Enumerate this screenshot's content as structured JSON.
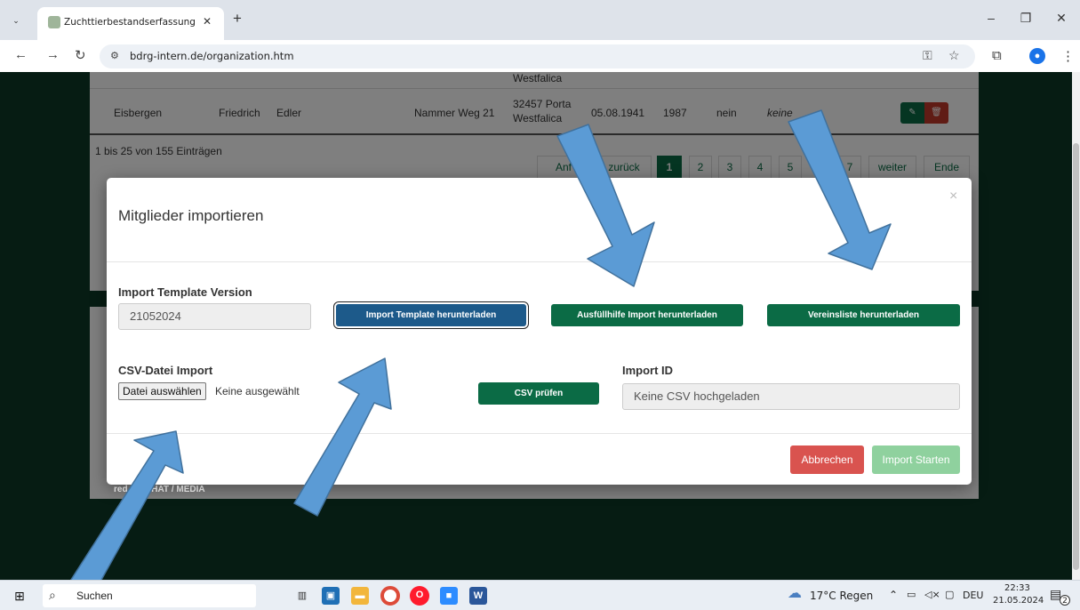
{
  "browser": {
    "tab_title": "Zuchttierbestandserfassung der",
    "url": "bdrg-intern.de/organization.htm"
  },
  "table": {
    "prev_row_city_fragment": "Westfalica",
    "row": {
      "lastname": "Eisbergen",
      "firstname": "Friedrich",
      "title": "Edler",
      "street": "Nammer Weg 21",
      "city_line1": "32457 Porta",
      "city_line2": "Westfalica",
      "birthdate": "05.08.1941",
      "joined": "1987",
      "flag": "nein",
      "note": "keine"
    },
    "entries_info": "1 bis 25 von 155 Einträgen",
    "pagination": {
      "first": "Anf",
      "prev": "zurück",
      "pages": [
        "1",
        "2",
        "3",
        "4",
        "5",
        "7"
      ],
      "next": "weiter",
      "last": "Ende"
    }
  },
  "footer": {
    "text": "red by WHAT / MEDIA"
  },
  "modal": {
    "title": "Mitglieder importieren",
    "close": "×",
    "template_version_label": "Import Template Version",
    "template_version_value": "21052024",
    "btn_template_download": "Import Template herunterladen",
    "btn_help_download": "Ausfüllhilfe Import herunterladen",
    "btn_club_list_download": "Vereinsliste herunterladen",
    "csv_label": "CSV-Datei Import",
    "file_button": "Datei auswählen",
    "file_status": "Keine ausgewählt",
    "btn_csv_check": "CSV prüfen",
    "import_id_label": "Import ID",
    "import_id_placeholder": "Keine CSV hochgeladen",
    "btn_cancel": "Abbrechen",
    "btn_start": "Import Starten"
  },
  "taskbar": {
    "search_label": "Suchen",
    "weather": "17°C Regen",
    "language": "DEU",
    "time": "22:33",
    "date": "21.05.2024",
    "notification_count": "2"
  },
  "colors": {
    "brand_green": "#0b6b45",
    "danger_red": "#d9534f",
    "success_light": "#8fd19e",
    "arrow_blue": "#5b9bd5"
  }
}
